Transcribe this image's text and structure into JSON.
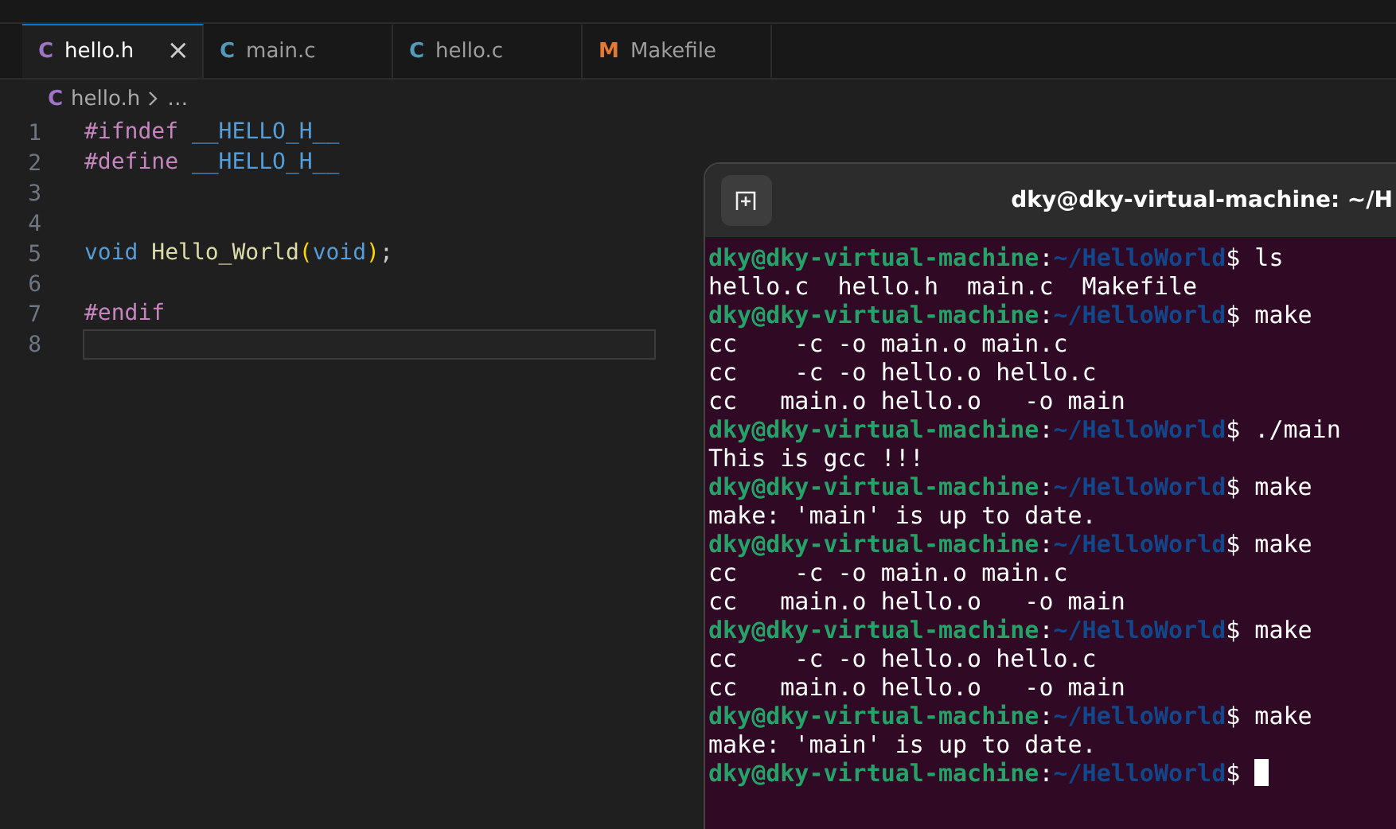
{
  "tabs": [
    {
      "icon": "C",
      "kind": "c-header",
      "label": "hello.h",
      "selected": true,
      "close": "×"
    },
    {
      "icon": "C",
      "kind": "c-source",
      "label": "main.c",
      "selected": false
    },
    {
      "icon": "C",
      "kind": "c-source",
      "label": "hello.c",
      "selected": false
    },
    {
      "icon": "M",
      "kind": "makefile",
      "label": "Makefile",
      "selected": false
    }
  ],
  "breadcrumb": {
    "icon": "C",
    "file": "hello.h",
    "more": "…"
  },
  "code_lines": [
    {
      "number": "1",
      "current": false,
      "tokens": [
        {
          "kind": "directive",
          "text": "#ifndef "
        },
        {
          "kind": "macro",
          "text": "__HELLO_H__"
        }
      ]
    },
    {
      "number": "2",
      "current": false,
      "tokens": [
        {
          "kind": "directive",
          "text": "#define "
        },
        {
          "kind": "macro",
          "text": "__HELLO_H__"
        }
      ]
    },
    {
      "number": "3",
      "current": false
    },
    {
      "number": "4",
      "current": false
    },
    {
      "number": "5",
      "current": false,
      "tokens": [
        {
          "kind": "keyword",
          "text": "void "
        },
        {
          "kind": "function",
          "text": "Hello_World"
        },
        {
          "kind": "bracket",
          "text": "("
        },
        {
          "kind": "keyword",
          "text": "void"
        },
        {
          "kind": "bracket",
          "text": ")"
        },
        {
          "kind": "plain",
          "text": ";"
        }
      ]
    },
    {
      "number": "6",
      "current": false
    },
    {
      "number": "7",
      "current": false,
      "tokens": [
        {
          "kind": "directive",
          "text": "#endif"
        }
      ]
    },
    {
      "number": "8",
      "current": true
    }
  ],
  "terminal": {
    "title": "dky@dky-virtual-machine: ~/H",
    "lines": [
      {
        "kind": "prompt",
        "host": "dky@dky-virtual-machine",
        "colon": ":",
        "path": "~/HelloWorld",
        "sign": "$",
        "command": "ls",
        "cursor": false
      },
      {
        "kind": "output",
        "text": "hello.c  hello.h  main.c  Makefile"
      },
      {
        "kind": "prompt",
        "host": "dky@dky-virtual-machine",
        "colon": ":",
        "path": "~/HelloWorld",
        "sign": "$",
        "command": "make",
        "cursor": false
      },
      {
        "kind": "output",
        "text": "cc    -c -o main.o main.c"
      },
      {
        "kind": "output",
        "text": "cc    -c -o hello.o hello.c"
      },
      {
        "kind": "output",
        "text": "cc   main.o hello.o   -o main"
      },
      {
        "kind": "prompt",
        "host": "dky@dky-virtual-machine",
        "colon": ":",
        "path": "~/HelloWorld",
        "sign": "$",
        "command": "./main",
        "cursor": false
      },
      {
        "kind": "output",
        "text": "This is gcc !!!"
      },
      {
        "kind": "prompt",
        "host": "dky@dky-virtual-machine",
        "colon": ":",
        "path": "~/HelloWorld",
        "sign": "$",
        "command": "make",
        "cursor": false
      },
      {
        "kind": "output",
        "text": "make: 'main' is up to date."
      },
      {
        "kind": "prompt",
        "host": "dky@dky-virtual-machine",
        "colon": ":",
        "path": "~/HelloWorld",
        "sign": "$",
        "command": "make",
        "cursor": false
      },
      {
        "kind": "output",
        "text": "cc    -c -o main.o main.c"
      },
      {
        "kind": "output",
        "text": "cc   main.o hello.o   -o main"
      },
      {
        "kind": "prompt",
        "host": "dky@dky-virtual-machine",
        "colon": ":",
        "path": "~/HelloWorld",
        "sign": "$",
        "command": "make",
        "cursor": false
      },
      {
        "kind": "output",
        "text": "cc    -c -o hello.o hello.c"
      },
      {
        "kind": "output",
        "text": "cc   main.o hello.o   -o main"
      },
      {
        "kind": "prompt",
        "host": "dky@dky-virtual-machine",
        "colon": ":",
        "path": "~/HelloWorld",
        "sign": "$",
        "command": "make",
        "cursor": false
      },
      {
        "kind": "output",
        "text": "make: 'main' is up to date."
      },
      {
        "kind": "prompt",
        "host": "dky@dky-virtual-machine",
        "colon": ":",
        "path": "~/HelloWorld",
        "sign": "$",
        "cursor": true
      }
    ]
  }
}
